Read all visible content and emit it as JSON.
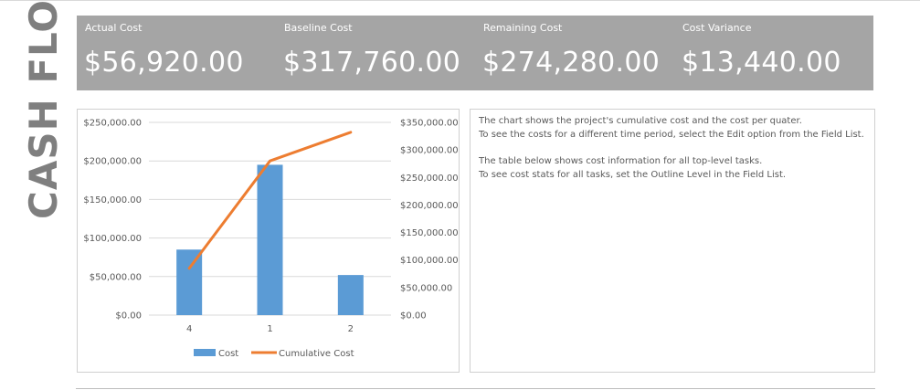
{
  "page": {
    "side_title": "CASH FLOW"
  },
  "kpis": [
    {
      "label": "Actual Cost",
      "value": "$56,920.00"
    },
    {
      "label": "Baseline Cost",
      "value": "$317,760.00"
    },
    {
      "label": "Remaining Cost",
      "value": "$274,280.00"
    },
    {
      "label": "Cost Variance",
      "value": "$13,440.00"
    }
  ],
  "notes": [
    "The chart shows the project's cumulative cost and the cost per quater.",
    "To see the costs for a different time period, select the Edit option from the Field List.",
    "",
    "The table below shows cost information for all top-level tasks.",
    "To see cost stats for all tasks, set the Outline Level in the Field List."
  ],
  "colors": {
    "bar": "#5b9bd5",
    "line": "#ed7d31",
    "kpi_band": "#a5a5a5"
  },
  "chart_data": {
    "type": "bar",
    "categories": [
      "4",
      "1",
      "2"
    ],
    "series": [
      {
        "name": "Cost",
        "type": "bar",
        "axis": "left",
        "values": [
          85000,
          195000,
          52000
        ]
      },
      {
        "name": "Cumulative Cost",
        "type": "line",
        "axis": "right",
        "values": [
          85000,
          280000,
          332000
        ]
      }
    ],
    "y_left": {
      "min": 0,
      "max": 250000,
      "ticks": [
        "$250,000.00",
        "$200,000.00",
        "$150,000.00",
        "$100,000.00",
        "$50,000.00",
        "$0.00"
      ],
      "tick_values": [
        250000,
        200000,
        150000,
        100000,
        50000,
        0
      ]
    },
    "y_right": {
      "min": 0,
      "max": 350000,
      "ticks": [
        "$350,000.00",
        "$300,000.00",
        "$250,000.00",
        "$200,000.00",
        "$150,000.00",
        "$100,000.00",
        "$50,000.00",
        "$0.00"
      ],
      "tick_values": [
        350000,
        300000,
        250000,
        200000,
        150000,
        100000,
        50000,
        0
      ]
    },
    "legend": [
      {
        "name": "Cost",
        "marker": "bar"
      },
      {
        "name": "Cumulative Cost",
        "marker": "line"
      }
    ],
    "legend_position": "bottom",
    "grid": true
  }
}
